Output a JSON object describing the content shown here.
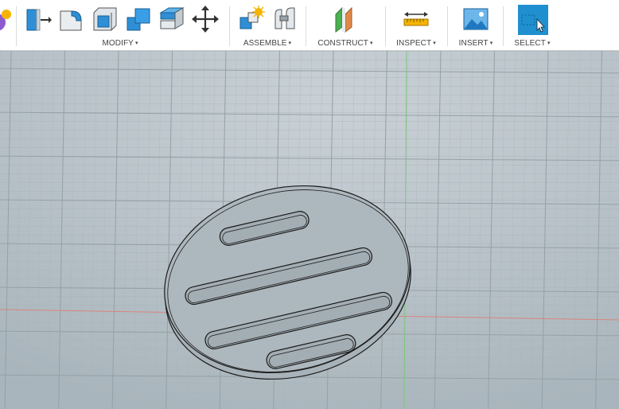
{
  "toolbar": {
    "groups": {
      "modify": {
        "label": "MODIFY",
        "icons": [
          "press-pull-icon",
          "fillet-icon",
          "shell-icon",
          "combine-icon",
          "replace-face-icon",
          "move-icon"
        ]
      },
      "assemble": {
        "label": "ASSEMBLE",
        "icons": [
          "new-component-icon",
          "joint-icon"
        ]
      },
      "construct": {
        "label": "CONSTRUCT",
        "icons": [
          "offset-plane-icon"
        ]
      },
      "inspect": {
        "label": "INSPECT",
        "icons": [
          "measure-icon"
        ]
      },
      "insert": {
        "label": "INSERT",
        "icons": [
          "insert-image-icon"
        ]
      },
      "select": {
        "label": "SELECT",
        "icons": [
          "select-cursor-icon"
        ]
      }
    },
    "dropdown_caret": "▾"
  },
  "viewport": {
    "background": "#b7c2c8",
    "grid_color": "#9fabb2",
    "axis_x_color": "#d9847c",
    "axis_y_color": "#7cc77c",
    "model": {
      "type": "oval plate with four rounded slots",
      "face_color": "#aab4ba",
      "edge_color": "#1a1a1a"
    }
  },
  "colors": {
    "accent_blue": "#2e8fd6",
    "select_active": "#1f8fcf",
    "construct_orange": "#e08a4a",
    "construct_green": "#4caf50",
    "star_yellow": "#f5b400"
  }
}
